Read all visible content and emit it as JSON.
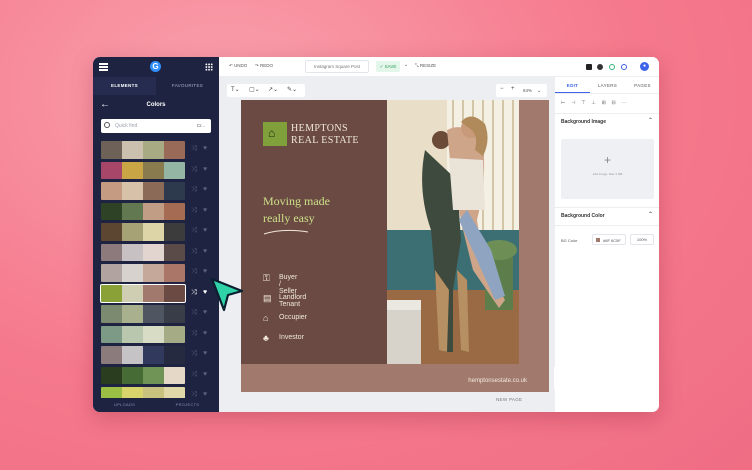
{
  "sidebar": {
    "tabs": [
      "ELEMENTS",
      "FAVOURITES"
    ],
    "title": "Colors",
    "search_placeholder": "Quick find",
    "search_hint": "Cr...",
    "bottom": [
      "UPLOADS",
      "PROJECTS"
    ],
    "selected_palette_index": 7,
    "palettes": [
      [
        "#6d6158",
        "#cbbfad",
        "#a7aa83",
        "#9a6a59"
      ],
      [
        "#a8466a",
        "#c9a545",
        "#8a7b4e",
        "#94b5a3"
      ],
      [
        "#c59b82",
        "#d7c1a8",
        "#8b6a58",
        "#2d3a4d"
      ],
      [
        "#2e4326",
        "#617850",
        "#c29d86",
        "#a56b53"
      ],
      [
        "#5d4631",
        "#a7a176",
        "#ddd5a7",
        "#3c3c3c"
      ],
      [
        "#8d7a7d",
        "#c7c1c4",
        "#e2d5cf",
        "#5a4b48"
      ],
      [
        "#b1a3a0",
        "#d7d2cd",
        "#c5a899",
        "#a97667"
      ],
      [
        "#8aa137",
        "#cfcdb2",
        "#a17a6d",
        "#6a4a42"
      ],
      [
        "#7c8a70",
        "#a8b08d",
        "#4f5661",
        "#393d47"
      ],
      [
        "#7d9a86",
        "#b8c7ad",
        "#d9dcc4",
        "#a5ab85"
      ],
      [
        "#8b7b7d",
        "#c6c3c7",
        "#313a5c",
        "#262a40"
      ],
      [
        "#2a3d1f",
        "#476b35",
        "#6f9456",
        "#e6d8c6"
      ],
      [
        "#9bbf45",
        "#d8d36a",
        "#c9c27e",
        "#e0d8a8"
      ]
    ]
  },
  "topbar": {
    "undo": "UNDO",
    "redo": "REDO",
    "doc_title": "Instagram Square Post",
    "saved": "SAVE",
    "resize": "RESIZE"
  },
  "canvas": {
    "zoom": "64%",
    "new_page": "NEW PAGE",
    "help": "?"
  },
  "design": {
    "brand_line1": "HEMPTONS",
    "brand_line2": "REAL ESTATE",
    "headline_line1": "Moving made",
    "headline_line2": "really easy",
    "services": [
      "Buyer / Seller",
      "Landlord Tenant",
      "Occupier",
      "Investor"
    ],
    "url": "hemptonsestate.co.uk",
    "bg_color": "#a17a6d",
    "panel_color": "#6a4a42",
    "accent_color": "#8aa137"
  },
  "right_panel": {
    "tabs": [
      "EDIT",
      "LAYERS",
      "PAGES"
    ],
    "bg_image_title": "Background Image",
    "upload_text": "Add Image, Max 4 MB",
    "bg_color_title": "Background Color",
    "bg_color_label": "BG Color",
    "bg_color_hex": "#8F 6C5F",
    "bg_opacity": "100%"
  }
}
